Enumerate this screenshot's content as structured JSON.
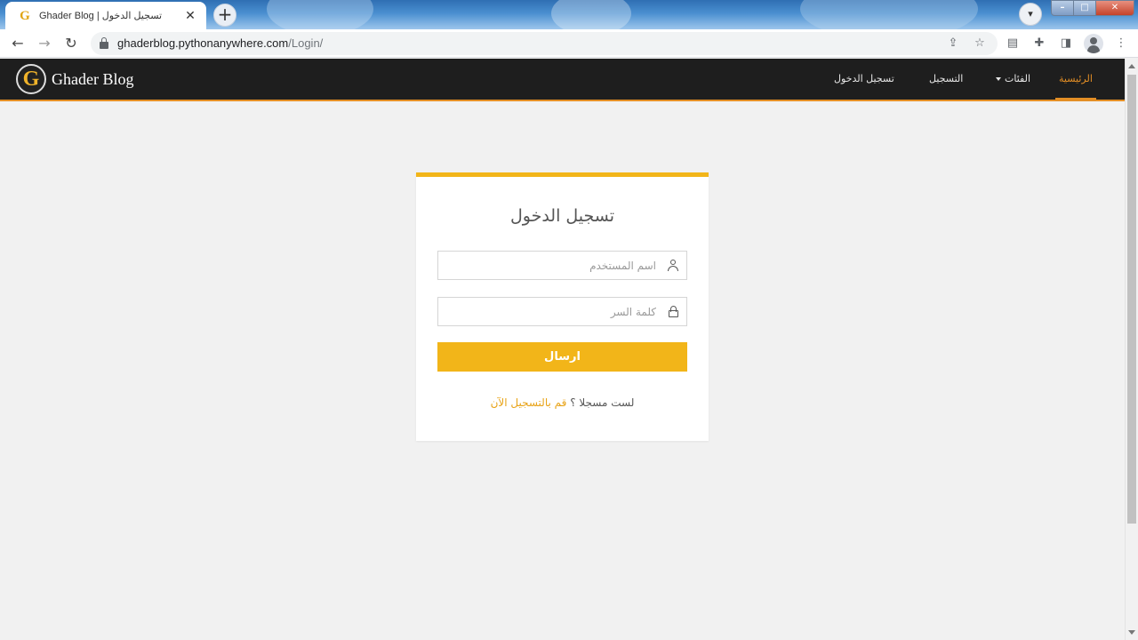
{
  "browser": {
    "tab_title": "Ghader Blog | تسجيل الدخول",
    "tab_favicon": "G",
    "tab_close": "✕",
    "new_tab": "+",
    "url_host": "ghaderblog.pythonanywhere.com",
    "url_path": "/Login/"
  },
  "site": {
    "logo_letter": "G",
    "logo_text": "Ghader Blog",
    "nav": {
      "home": "الرئيسية",
      "categories": "الفئات",
      "register": "التسجيل",
      "login": "تسجيل الدخول"
    },
    "accent_color": "#f2b519",
    "nav_accent_color": "#e38e25"
  },
  "login": {
    "title": "تسجيل الدخول",
    "username_placeholder": "اسم المستخدم",
    "password_placeholder": "كلمة السر",
    "submit_label": "ارسال",
    "register_prompt": "لست مسجلا ؟",
    "register_link": "قم بالتسجيل الآن"
  }
}
